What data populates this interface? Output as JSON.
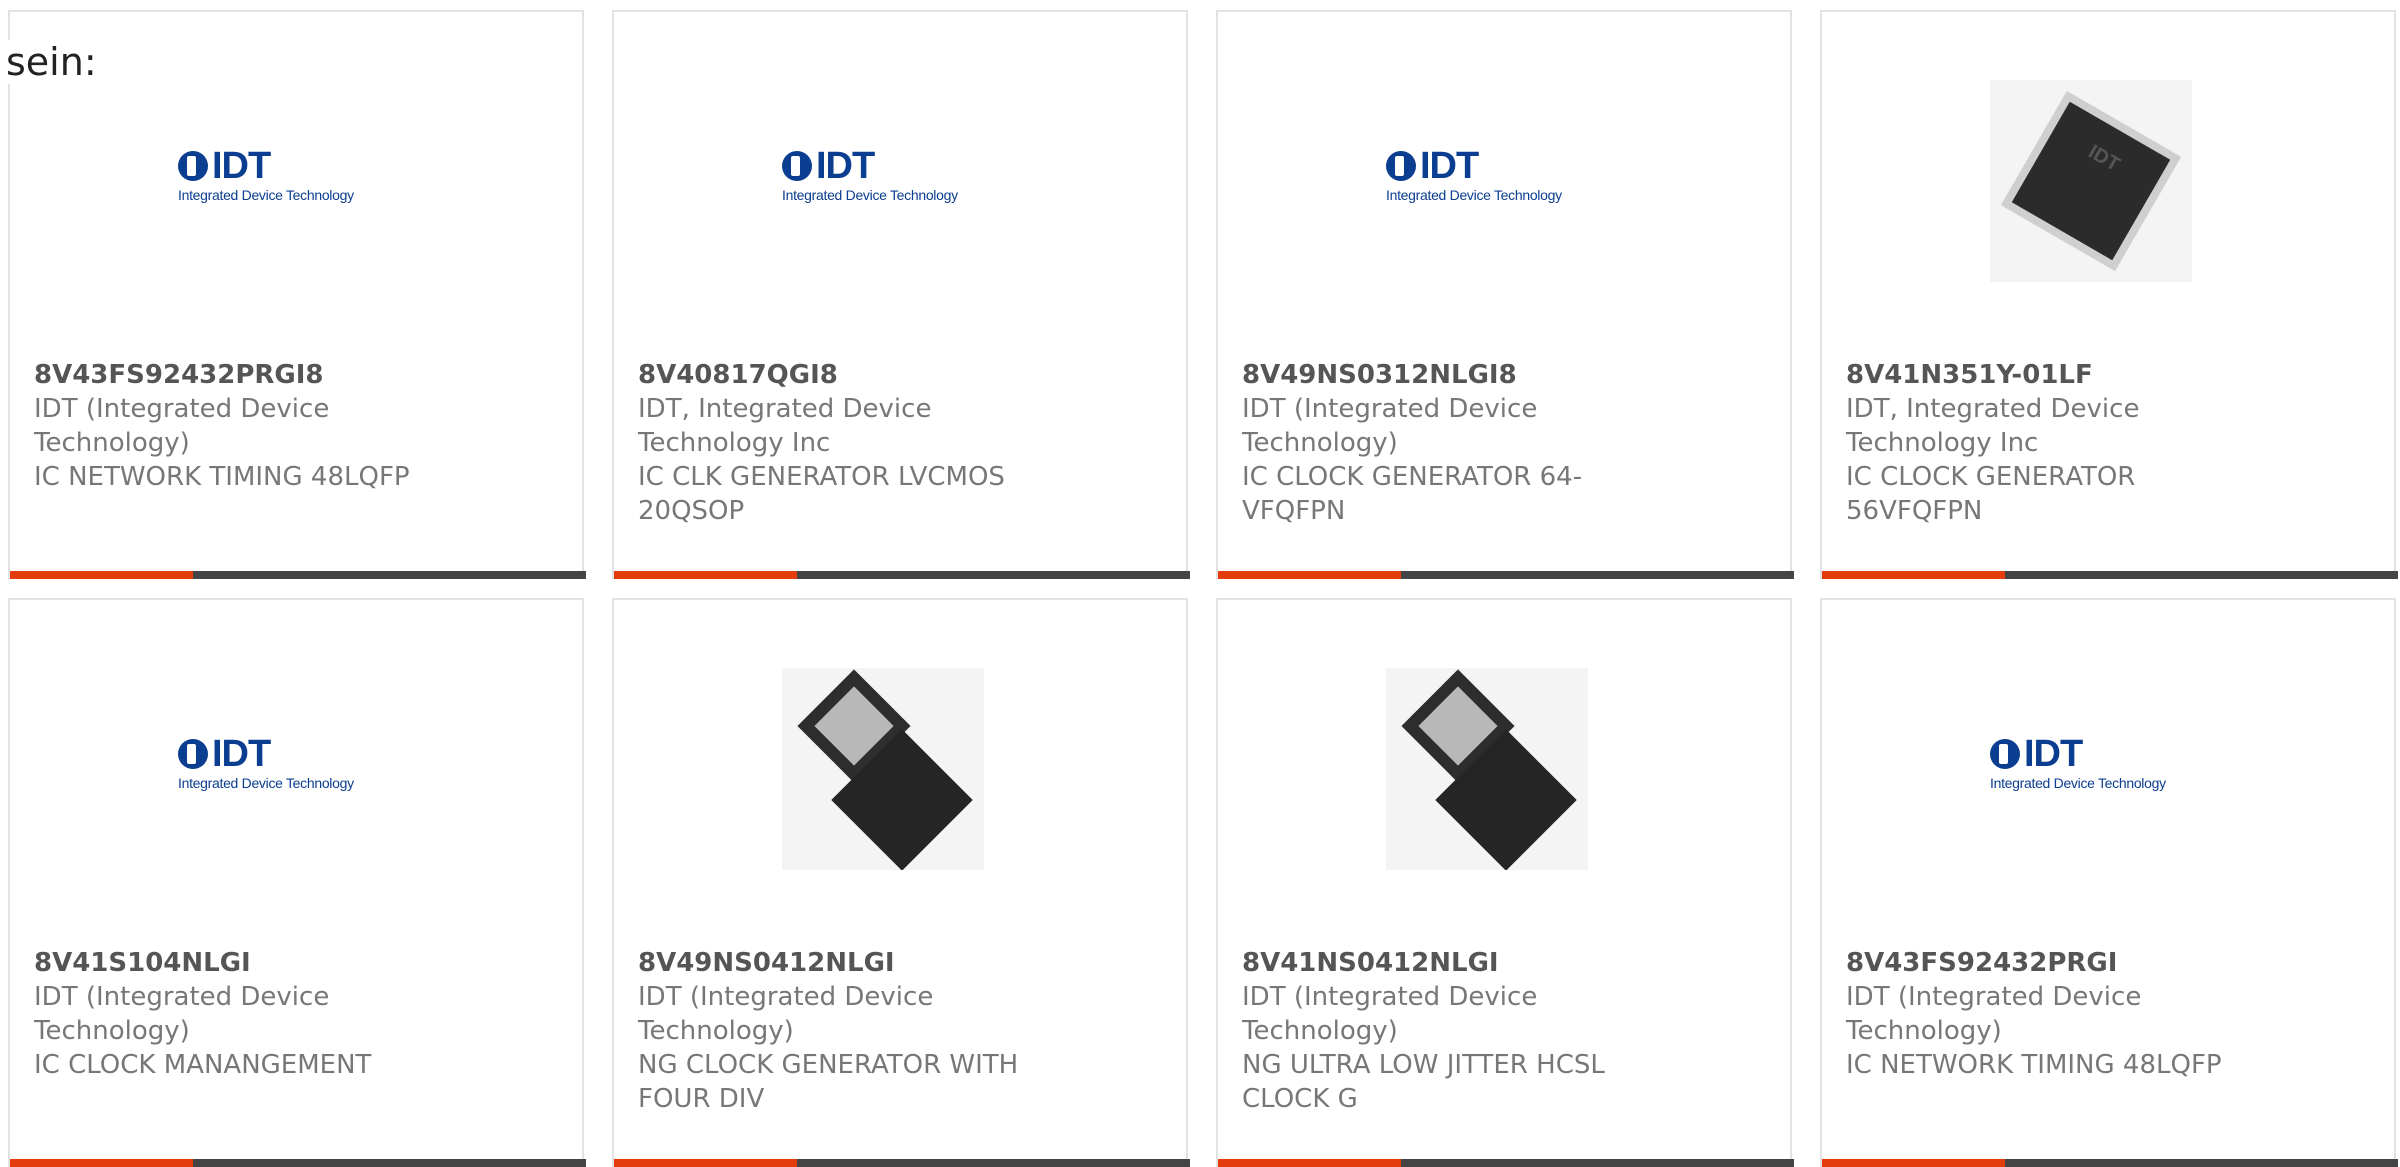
{
  "intro_text": "sein:",
  "colors": {
    "accent": "#e53c0b",
    "bar": "#444444",
    "brand": "#0b3d91"
  },
  "logo": {
    "word": "IDT",
    "sub": "Integrated Device Technology"
  },
  "products": [
    {
      "part": "8V43FS92432PRGI8",
      "mfr": "IDT (Integrated Device Technology)",
      "desc": "IC NETWORK TIMING 48LQFP",
      "image": "idt-logo"
    },
    {
      "part": "8V40817QGI8",
      "mfr": "IDT, Integrated Device Technology Inc",
      "desc": "IC CLK GENERATOR LVCMOS 20QSOP",
      "image": "idt-logo"
    },
    {
      "part": "8V49NS0312NLGI8",
      "mfr": "IDT (Integrated Device Technology)",
      "desc": "IC CLOCK GENERATOR 64-VFQFPN",
      "image": "idt-logo"
    },
    {
      "part": "8V41N351Y-01LF",
      "mfr": "IDT, Integrated Device Technology Inc",
      "desc": "IC CLOCK GENERATOR 56VFQFPN",
      "image": "qfp-chip"
    },
    {
      "part": "8V41S104NLGI",
      "mfr": "IDT (Integrated Device Technology)",
      "desc": "IC CLOCK MANANGEMENT",
      "image": "idt-logo"
    },
    {
      "part": "8V49NS0412NLGI",
      "mfr": "IDT (Integrated Device Technology)",
      "desc": "NG CLOCK GENERATOR WITH FOUR DIV",
      "image": "qfn-chips"
    },
    {
      "part": "8V41NS0412NLGI",
      "mfr": "IDT (Integrated Device Technology)",
      "desc": "NG ULTRA LOW JITTER HCSL CLOCK G",
      "image": "qfn-chips"
    },
    {
      "part": "8V43FS92432PRGI",
      "mfr": "IDT (Integrated Device Technology)",
      "desc": "IC NETWORK TIMING 48LQFP",
      "image": "idt-logo"
    }
  ]
}
